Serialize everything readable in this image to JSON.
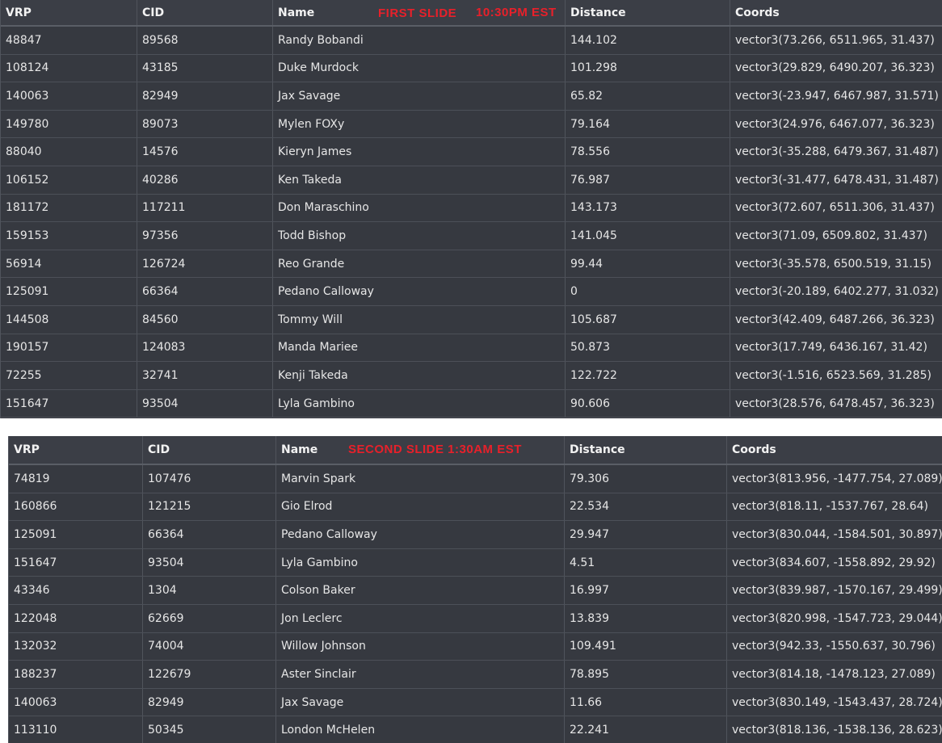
{
  "tables": [
    {
      "slide_label": "FIRST SLIDE",
      "slide_time": "10:30PM EST",
      "columns": [
        "VRP",
        "CID",
        "Name",
        "Distance",
        "Coords"
      ],
      "rows": [
        [
          "48847",
          "89568",
          "Randy Bobandi",
          "144.102",
          "vector3(73.266, 6511.965, 31.437)"
        ],
        [
          "108124",
          "43185",
          "Duke Murdock",
          "101.298",
          "vector3(29.829, 6490.207, 36.323)"
        ],
        [
          "140063",
          "82949",
          "Jax Savage",
          "65.82",
          "vector3(-23.947, 6467.987, 31.571)"
        ],
        [
          "149780",
          "89073",
          "Mylen FOXy",
          "79.164",
          "vector3(24.976, 6467.077, 36.323)"
        ],
        [
          "88040",
          "14576",
          "Kieryn James",
          "78.556",
          "vector3(-35.288, 6479.367, 31.487)"
        ],
        [
          "106152",
          "40286",
          "Ken Takeda",
          "76.987",
          "vector3(-31.477, 6478.431, 31.487)"
        ],
        [
          "181172",
          "117211",
          "Don Maraschino",
          "143.173",
          "vector3(72.607, 6511.306, 31.437)"
        ],
        [
          "159153",
          "97356",
          "Todd Bishop",
          "141.045",
          "vector3(71.09, 6509.802, 31.437)"
        ],
        [
          "56914",
          "126724",
          "Reo Grande",
          "99.44",
          "vector3(-35.578, 6500.519, 31.15)"
        ],
        [
          "125091",
          "66364",
          "Pedano Calloway",
          "0",
          "vector3(-20.189, 6402.277, 31.032)"
        ],
        [
          "144508",
          "84560",
          "Tommy Will",
          "105.687",
          "vector3(42.409, 6487.266, 36.323)"
        ],
        [
          "190157",
          "124083",
          "Manda Mariee",
          "50.873",
          "vector3(17.749, 6436.167, 31.42)"
        ],
        [
          "72255",
          "32741",
          "Kenji Takeda",
          "122.722",
          "vector3(-1.516, 6523.569, 31.285)"
        ],
        [
          "151647",
          "93504",
          "Lyla Gambino",
          "90.606",
          "vector3(28.576, 6478.457, 36.323)"
        ]
      ]
    },
    {
      "slide_label": "SECOND SLIDE 1:30AM EST",
      "columns": [
        "VRP",
        "CID",
        "Name",
        "Distance",
        "Coords"
      ],
      "rows": [
        [
          "74819",
          "107476",
          "Marvin Spark",
          "79.306",
          "vector3(813.956, -1477.754, 27.089)"
        ],
        [
          "160866",
          "121215",
          "Gio Elrod",
          "22.534",
          "vector3(818.11, -1537.767, 28.64)"
        ],
        [
          "125091",
          "66364",
          "Pedano Calloway",
          "29.947",
          "vector3(830.044, -1584.501, 30.897)"
        ],
        [
          "151647",
          "93504",
          "Lyla Gambino",
          "4.51",
          "vector3(834.607, -1558.892, 29.92)"
        ],
        [
          "43346",
          "1304",
          "Colson Baker",
          "16.997",
          "vector3(839.987, -1570.167, 29.499)"
        ],
        [
          "122048",
          "62669",
          "Jon Leclerc",
          "13.839",
          "vector3(820.998, -1547.723, 29.044)"
        ],
        [
          "132032",
          "74004",
          "Willow Johnson",
          "109.491",
          "vector3(942.33, -1550.637, 30.796)"
        ],
        [
          "188237",
          "122679",
          "Aster Sinclair",
          "78.895",
          "vector3(814.18, -1478.123, 27.089)"
        ],
        [
          "140063",
          "82949",
          "Jax Savage",
          "11.66",
          "vector3(830.149, -1543.437, 28.724)"
        ],
        [
          "113110",
          "50345",
          "London McHelen",
          "22.241",
          "vector3(818.136, -1538.136, 28.623)"
        ]
      ]
    }
  ]
}
